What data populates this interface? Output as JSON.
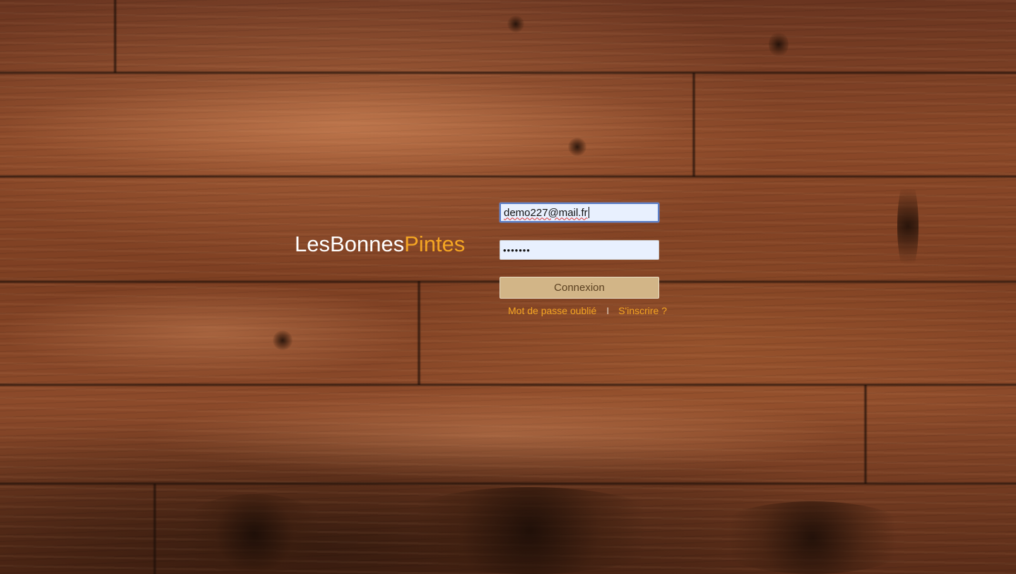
{
  "logo": {
    "part1": "LesBonnes",
    "part2": "Pintes"
  },
  "login": {
    "email_value": "demo227@mail.fr",
    "password_value": "•••••••",
    "submit_label": "Connexion",
    "forgot_label": "Mot de passe oublié",
    "separator": "I",
    "signup_label": "S'inscrire ?"
  },
  "colors": {
    "accent": "#f5a623",
    "button_bg": "#d2b587",
    "input_bg": "#e8f0fe"
  }
}
